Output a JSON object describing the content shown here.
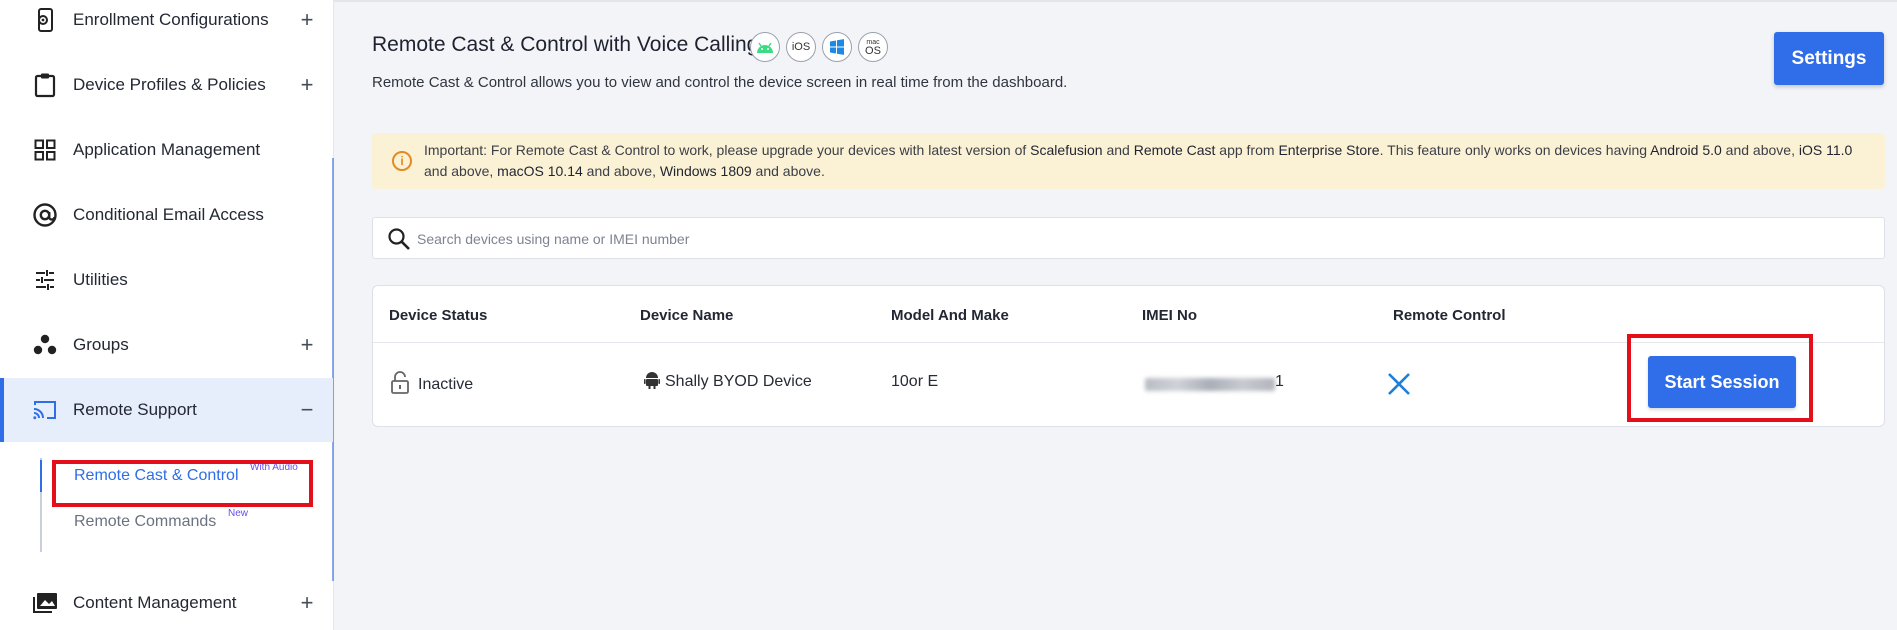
{
  "sidebar": {
    "items": [
      {
        "label": "Enrollment Configurations",
        "icon": "mobile-gear-icon",
        "expander": "+"
      },
      {
        "label": "Device Profiles & Policies",
        "icon": "clipboard-icon",
        "expander": "+"
      },
      {
        "label": "Application Management",
        "icon": "grid-apps-icon",
        "expander": ""
      },
      {
        "label": "Conditional Email Access",
        "icon": "at-sign-icon",
        "expander": ""
      },
      {
        "label": "Utilities",
        "icon": "sliders-icon",
        "expander": ""
      },
      {
        "label": "Groups",
        "icon": "groups-icon",
        "expander": "+"
      },
      {
        "label": "Remote Support",
        "icon": "cast-icon",
        "expander": "−"
      },
      {
        "label": "Content Management",
        "icon": "images-icon",
        "expander": "+"
      }
    ],
    "sub_items": [
      {
        "label": "Remote Cast & Control",
        "badge": "With Audio"
      },
      {
        "label": "Remote Commands",
        "badge": "New"
      }
    ]
  },
  "main": {
    "title": "Remote Cast & Control with Voice Calling",
    "os_icons": [
      "android-icon",
      "ios-icon",
      "windows-icon",
      "macos-icon"
    ],
    "os_ios_label": "iOS",
    "os_mac_label_top": "mac",
    "os_mac_label": "OS",
    "subtitle": "Remote Cast & Control allows you to view and control the device screen in real time from the dashboard.",
    "settings_label": "Settings",
    "notice": {
      "p1": "Important: For Remote Cast & Control to work, please upgrade your devices with latest version of ",
      "b1": "Scalefusion",
      "p2": " and ",
      "b2": "Remote Cast",
      "p3": " app from ",
      "b3": "Enterprise Store",
      "p4": ". This feature only works on devices having ",
      "b4": "Android 5.0",
      "p5": " and above, ",
      "b5": "iOS 11.0",
      "p6": " and above, ",
      "b6": "macOS 10.14",
      "p7": " and above, ",
      "b7": "Windows 1809",
      "p8": " and above."
    },
    "search_placeholder": "Search devices using name or IMEI number",
    "table": {
      "headers": [
        "Device Status",
        "Device Name",
        "Model And Make",
        "IMEI No",
        "Remote Control"
      ],
      "rows": [
        {
          "status": "Inactive",
          "device_name": "Shally BYOD Device",
          "model": "10or E",
          "imei_suffix": "1",
          "action": "Start Session"
        }
      ]
    }
  },
  "colors": {
    "accent": "#2f6ee8",
    "highlight": "#e3101c",
    "notice_bg": "#fbf1d5",
    "android": "#3ddc84",
    "windows": "#1e88e5"
  }
}
